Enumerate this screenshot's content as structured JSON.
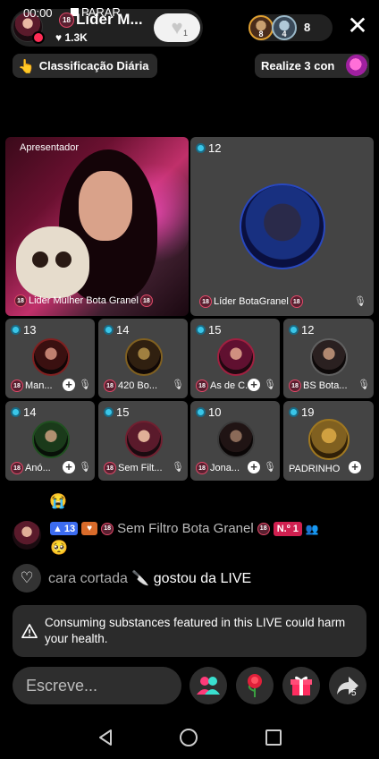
{
  "status": {
    "time": "00:00",
    "stop_label": "PARAR"
  },
  "host": {
    "badge": "18",
    "name": "Lider M...",
    "likes": "1.3K",
    "follow_count": "1"
  },
  "viewers": {
    "avatar1_level": "8",
    "avatar2_level": "4",
    "count": "8"
  },
  "chips": {
    "ranking": "Classificação Diária",
    "task": "Realize 3 con"
  },
  "grid": {
    "presenter_label": "Apresentador",
    "host_tile": {
      "name": "Lider Mulher Bota Granel"
    },
    "big_guest": {
      "number": "12",
      "name": "Líder BotaGranel"
    },
    "guests": [
      {
        "number": "13",
        "name": "Man..."
      },
      {
        "number": "14",
        "name": "420 Bo..."
      },
      {
        "number": "15",
        "name": "As de C..."
      },
      {
        "number": "12",
        "name": "BS Bota..."
      },
      {
        "number": "14",
        "name": "Anó..."
      },
      {
        "number": "15",
        "name": "Sem Filt..."
      },
      {
        "number": "10",
        "name": "Jona..."
      },
      {
        "number": "19",
        "name": "PADRINHO"
      }
    ]
  },
  "chat": {
    "emoji_line": "😭",
    "level": "13",
    "user": "Sem Filtro Bota Granel",
    "rank": "N.º 1",
    "message": "🥺"
  },
  "like_notice": {
    "user": "cara cortada 🔪",
    "action": "gostou da LIVE"
  },
  "warning": {
    "text": "Consuming substances featured in this LIVE could harm your health."
  },
  "bottom": {
    "comment_placeholder": "Escreve...",
    "share_count": "5"
  },
  "colors": {
    "accent_pink": "#fe2c55",
    "badge_cyan": "#3ac6e8",
    "tile_bg": "#444444"
  }
}
